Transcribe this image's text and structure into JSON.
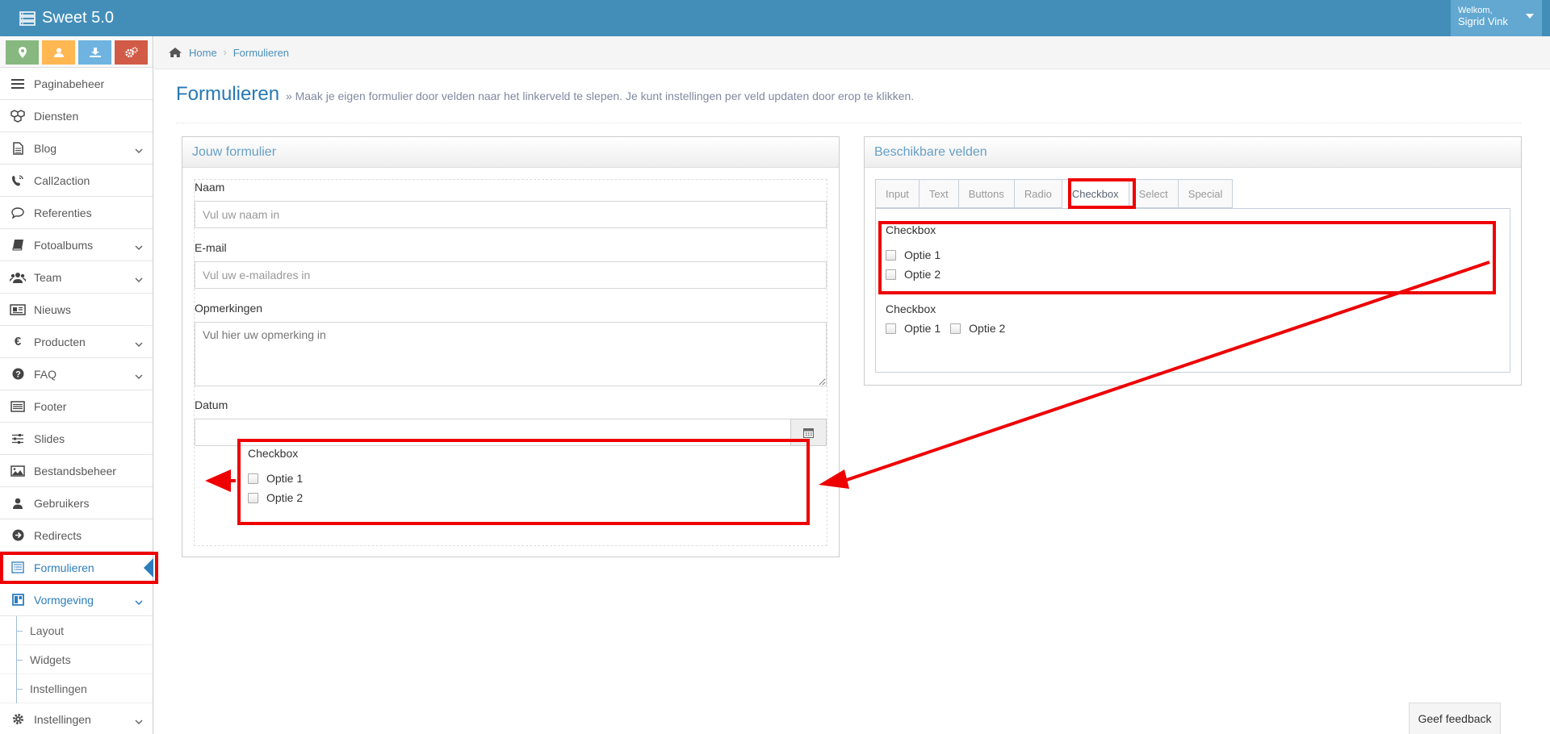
{
  "app": {
    "title": "Sweet 5.0",
    "user_greeting": "Welkom,",
    "user_name": "Sigrid Vink"
  },
  "shortcuts": [
    {
      "icon": "map-marker-icon",
      "color": "#87b87f"
    },
    {
      "icon": "user-icon",
      "color": "#ffb752"
    },
    {
      "icon": "download-icon",
      "color": "#6fb3e0"
    },
    {
      "icon": "cogs-icon",
      "color": "#d15b47"
    }
  ],
  "sidebar": {
    "items": [
      {
        "label": "Paginabeheer",
        "icon": "bars-icon"
      },
      {
        "label": "Diensten",
        "icon": "cubes-icon"
      },
      {
        "label": "Blog",
        "icon": "file-text-icon"
      },
      {
        "label": "Call2action",
        "icon": "phone-volume-icon"
      },
      {
        "label": "Referenties",
        "icon": "comment-icon"
      },
      {
        "label": "Fotoalbums",
        "icon": "book-icon"
      },
      {
        "label": "Team",
        "icon": "users-icon"
      },
      {
        "label": "Nieuws",
        "icon": "newspaper-icon"
      },
      {
        "label": "Producten",
        "icon": "euro-icon"
      },
      {
        "label": "FAQ",
        "icon": "question-circle-icon"
      },
      {
        "label": "Footer",
        "icon": "list-alt-icon"
      },
      {
        "label": "Slides",
        "icon": "sliders-icon"
      },
      {
        "label": "Bestandsbeheer",
        "icon": "image-icon"
      },
      {
        "label": "Gebruikers",
        "icon": "user-icon"
      },
      {
        "label": "Redirects",
        "icon": "arrow-circle-right-icon"
      },
      {
        "label": "Formulieren",
        "icon": "form-icon"
      },
      {
        "label": "Vormgeving",
        "icon": "layout-icon"
      },
      {
        "label": "Instellingen",
        "icon": "cog-icon"
      }
    ],
    "sub_items": [
      {
        "label": "Layout"
      },
      {
        "label": "Widgets"
      },
      {
        "label": "Instellingen"
      }
    ]
  },
  "breadcrumb": {
    "home": "Home",
    "current": "Formulieren"
  },
  "page": {
    "title": "Formulieren",
    "description": "» Maak je eigen formulier door velden naar het linkerveld te slepen. Je kunt instellingen per veld updaten door erop te klikken."
  },
  "form_widget": {
    "title": "Jouw formulier",
    "fields": {
      "name_label": "Naam",
      "name_placeholder": "Vul uw naam in",
      "email_label": "E-mail",
      "email_placeholder": "Vul uw e-mailadres in",
      "remarks_label": "Opmerkingen",
      "remarks_placeholder": "Vul hier uw opmerking in",
      "date_label": "Datum"
    },
    "checkbox_group": {
      "title": "Checkbox",
      "option1": "Optie 1",
      "option2": "Optie 2"
    }
  },
  "fields_widget": {
    "title": "Beschikbare velden",
    "tabs": [
      "Input",
      "Text",
      "Buttons",
      "Radio",
      "Checkbox",
      "Select",
      "Special"
    ],
    "active_tab": "Checkbox",
    "stacked": {
      "title": "Checkbox",
      "option1": "Optie 1",
      "option2": "Optie 2"
    },
    "inline": {
      "title": "Checkbox",
      "option1": "Optie 1",
      "option2": "Optie 2"
    }
  },
  "feedback": {
    "label": "Geef feedback"
  },
  "colors": {
    "topbar": "#438eb9",
    "accent": "#2b7dbc",
    "highlight": "#e00000"
  }
}
